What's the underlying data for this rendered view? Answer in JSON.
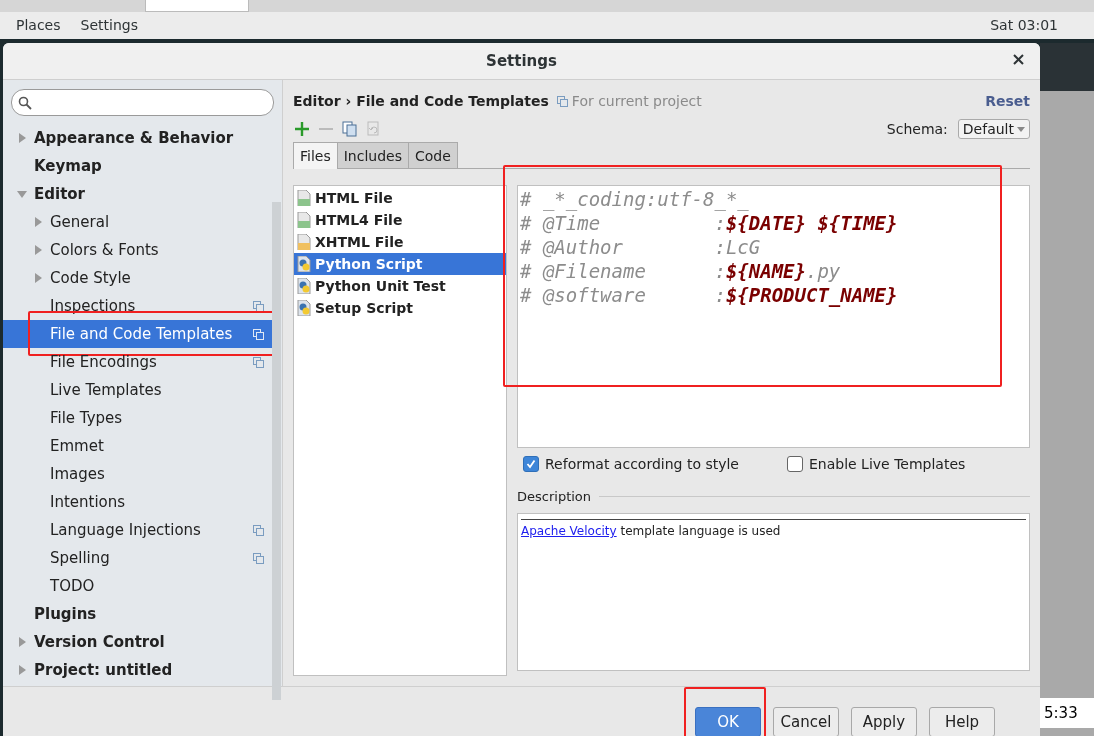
{
  "desktop": {
    "menu": [
      "Places",
      "Settings"
    ],
    "clock": "Sat 03:01",
    "corner_clock": "5:33"
  },
  "dialog": {
    "title": "Settings"
  },
  "sidebar": {
    "items": [
      {
        "label": "Appearance & Behavior",
        "expanded": false,
        "selected": false
      },
      {
        "label": "Keymap",
        "selected": false
      },
      {
        "label": "Editor",
        "expanded": true,
        "selected": false,
        "children": [
          {
            "label": "General",
            "expanded": false,
            "selected": false
          },
          {
            "label": "Colors & Fonts",
            "expanded": false,
            "selected": false
          },
          {
            "label": "Code Style",
            "expanded": false,
            "selected": false
          },
          {
            "label": "Inspections",
            "scoped": true,
            "selected": false
          },
          {
            "label": "File and Code Templates",
            "scoped": true,
            "selected": true,
            "highlighted": true
          },
          {
            "label": "File Encodings",
            "scoped": true,
            "selected": false
          },
          {
            "label": "Live Templates",
            "selected": false
          },
          {
            "label": "File Types",
            "selected": false
          },
          {
            "label": "Emmet",
            "selected": false
          },
          {
            "label": "Images",
            "selected": false
          },
          {
            "label": "Intentions",
            "selected": false
          },
          {
            "label": "Language Injections",
            "scoped": true,
            "selected": false
          },
          {
            "label": "Spelling",
            "scoped": true,
            "selected": false
          },
          {
            "label": "TODO",
            "selected": false
          }
        ]
      },
      {
        "label": "Plugins",
        "selected": false
      },
      {
        "label": "Version Control",
        "expanded": false,
        "selected": false
      },
      {
        "label": "Project: untitled",
        "expanded": false,
        "selected": false
      }
    ]
  },
  "breadcrumb": {
    "parent": "Editor",
    "separator": "›",
    "current": "File and Code Templates",
    "scope": "For current project",
    "reset": "Reset"
  },
  "toolbar": {
    "tools": [
      {
        "kind": "add",
        "disabled": false
      },
      {
        "kind": "remove",
        "disabled": true
      },
      {
        "kind": "copy",
        "disabled": false
      },
      {
        "kind": "reset",
        "disabled": true
      }
    ],
    "schema_label": "Schema:",
    "schema_value": "Default"
  },
  "tabs": [
    {
      "label": "Files",
      "selected": true
    },
    {
      "label": "Includes",
      "selected": false
    },
    {
      "label": "Code",
      "selected": false
    }
  ],
  "templates": [
    {
      "name": "HTML File",
      "kind": "html",
      "selected": false
    },
    {
      "name": "HTML4 File",
      "kind": "html",
      "selected": false
    },
    {
      "name": "XHTML File",
      "kind": "xhtml",
      "selected": false
    },
    {
      "name": "Python Script",
      "kind": "python",
      "selected": true
    },
    {
      "name": "Python Unit Test",
      "kind": "python",
      "selected": false
    },
    {
      "name": "Setup Script",
      "kind": "python",
      "selected": false
    }
  ],
  "editor": {
    "highlighted": true,
    "lines": [
      [
        {
          "text": "# _*_coding:utf-8_*_",
          "kind": "comment"
        }
      ],
      [
        {
          "text": "# @Time          :",
          "kind": "comment"
        },
        {
          "text": "${DATE} ${TIME}",
          "kind": "variable"
        }
      ],
      [
        {
          "text": "# @Author        :LcG",
          "kind": "comment"
        }
      ],
      [
        {
          "text": "# @Filename      :",
          "kind": "comment"
        },
        {
          "text": "${NAME}",
          "kind": "variable"
        },
        {
          "text": ".py",
          "kind": "comment"
        }
      ],
      [
        {
          "text": "# @software      :",
          "kind": "comment"
        },
        {
          "text": "${PRODUCT_NAME}",
          "kind": "variable"
        }
      ]
    ]
  },
  "options": [
    {
      "label": "Reformat according to style",
      "checked": true
    },
    {
      "label": "Enable Live Templates",
      "checked": false
    }
  ],
  "description": {
    "title": "Description",
    "link": "Apache Velocity",
    "text": " template language is used"
  },
  "buttons": [
    {
      "label": "OK",
      "kind": "primary",
      "highlighted": true
    },
    {
      "label": "Cancel",
      "kind": "normal"
    },
    {
      "label": "Apply",
      "kind": "normal"
    },
    {
      "label": "Help",
      "kind": "normal"
    }
  ]
}
